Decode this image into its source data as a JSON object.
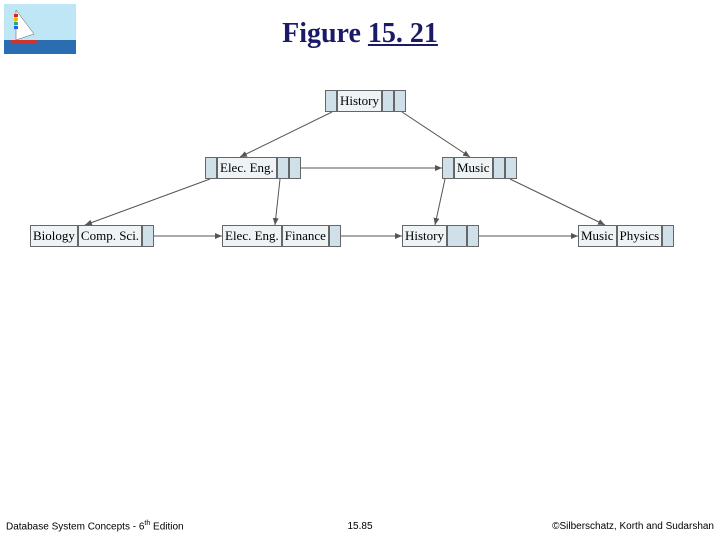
{
  "title_pre": "Figure ",
  "title_num": "15. 21",
  "tree": {
    "root": {
      "label": "History"
    },
    "mid": [
      {
        "label": "Elec. Eng."
      },
      {
        "label": "Music"
      }
    ],
    "leaves": [
      {
        "label": "Biology"
      },
      {
        "label": "Comp. Sci."
      },
      {
        "label": "Elec. Eng."
      },
      {
        "label": "Finance"
      },
      {
        "label": "History"
      },
      {
        "label": "Music"
      },
      {
        "label": "Physics"
      }
    ]
  },
  "footer": {
    "left_a": "Database System Concepts - 6",
    "left_sup": "th",
    "left_b": " Edition",
    "center": "15.85",
    "right": "©Silberschatz, Korth and Sudarshan"
  }
}
